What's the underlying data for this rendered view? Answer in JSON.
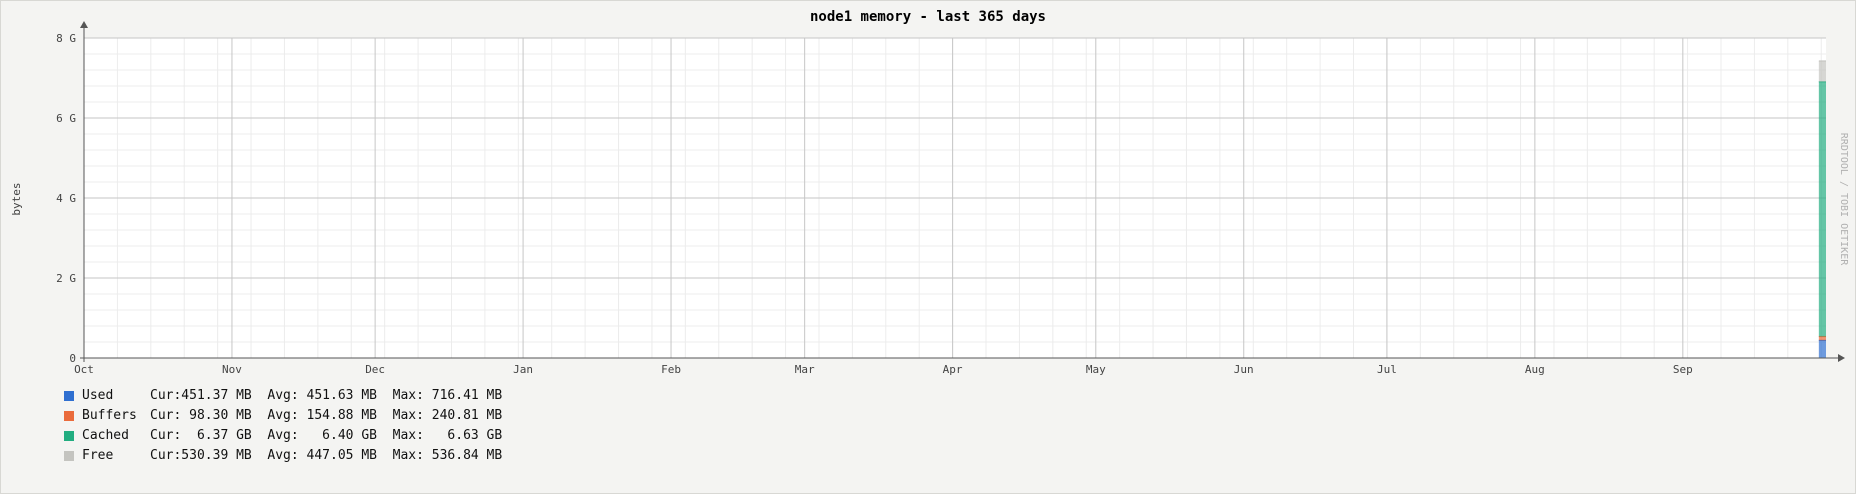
{
  "chart_data": {
    "type": "area",
    "title": "node1 memory - last 365 days",
    "ylabel": "bytes",
    "watermark": "RRDTOOL / TOBI OETIKER",
    "ylim": [
      0,
      8
    ],
    "y_unit": "G",
    "y_ticks": [
      {
        "value": 0,
        "label": "0"
      },
      {
        "value": 2,
        "label": "2 G"
      },
      {
        "value": 4,
        "label": "4 G"
      },
      {
        "value": 6,
        "label": "6 G"
      },
      {
        "value": 8,
        "label": "8 G"
      }
    ],
    "x_range_days": [
      0,
      365
    ],
    "x_ticks": [
      {
        "label": "Oct",
        "day": 0
      },
      {
        "label": "Nov",
        "day": 31
      },
      {
        "label": "Dec",
        "day": 61
      },
      {
        "label": "Jan",
        "day": 92
      },
      {
        "label": "Feb",
        "day": 123
      },
      {
        "label": "Mar",
        "day": 151
      },
      {
        "label": "Apr",
        "day": 182
      },
      {
        "label": "May",
        "day": 212
      },
      {
        "label": "Jun",
        "day": 243
      },
      {
        "label": "Jul",
        "day": 273
      },
      {
        "label": "Aug",
        "day": 304
      },
      {
        "label": "Sep",
        "day": 335
      }
    ],
    "data_start_day": 363.5,
    "series": [
      {
        "name": "Used",
        "color": "#2f6fd0",
        "value_gb": 0.441,
        "cur": "451.37 MB",
        "avg": "451.63 MB",
        "max": "716.41 MB"
      },
      {
        "name": "Buffers",
        "color": "#ea6b3c",
        "value_gb": 0.096,
        "cur": " 98.30 MB",
        "avg": "154.88 MB",
        "max": "240.81 MB"
      },
      {
        "name": "Cached",
        "color": "#22ad80",
        "value_gb": 6.37,
        "cur": "  6.37 GB",
        "avg": "  6.40 GB",
        "max": "  6.63 GB"
      },
      {
        "name": "Free",
        "color": "#c4c4c0",
        "value_gb": 0.518,
        "cur": "530.39 MB",
        "avg": "447.05 MB",
        "max": "536.84 MB"
      }
    ],
    "legend_labels": {
      "cur": "Cur:",
      "avg": "Avg:",
      "max": "Max:"
    },
    "grid": true,
    "legend_position": "bottom-left"
  }
}
